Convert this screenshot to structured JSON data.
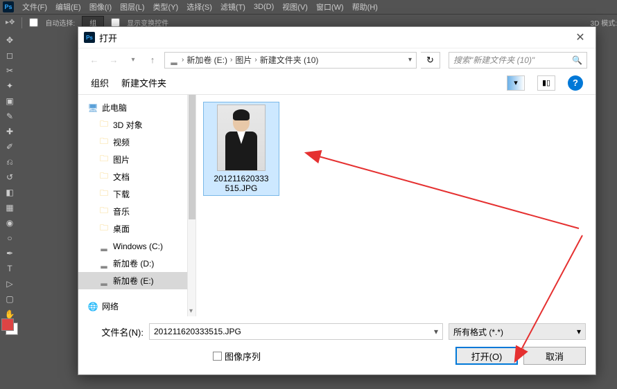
{
  "ps_menu": [
    "文件(F)",
    "编辑(E)",
    "图像(I)",
    "图层(L)",
    "类型(Y)",
    "选择(S)",
    "滤镜(T)",
    "3D(D)",
    "视图(V)",
    "窗口(W)",
    "帮助(H)"
  ],
  "ps_opt": {
    "auto_select": "自动选择:",
    "group": "组",
    "show_transform": "显示变换控件",
    "mode_3d": "3D 模式:"
  },
  "dialog": {
    "title": "打开",
    "path_segs": [
      "新加卷 (E:)",
      "图片",
      "新建文件夹 (10)"
    ],
    "search_placeholder": "搜索\"新建文件夹 (10)\"",
    "organize": "组织",
    "new_folder": "新建文件夹"
  },
  "tree": {
    "this_pc": "此电脑",
    "items": [
      "3D 对象",
      "视频",
      "图片",
      "文档",
      "下载",
      "音乐",
      "桌面",
      "Windows (C:)",
      "新加卷 (D:)",
      "新加卷 (E:)"
    ],
    "network": "网络"
  },
  "file": {
    "name_lines": [
      "201211620333",
      "515.JPG"
    ]
  },
  "footer": {
    "filename_label": "文件名(N):",
    "filename_value": "201211620333515.JPG",
    "filter": "所有格式 (*.*)",
    "sequence": "图像序列",
    "open_btn": "打开(O)",
    "cancel_btn": "取消"
  }
}
